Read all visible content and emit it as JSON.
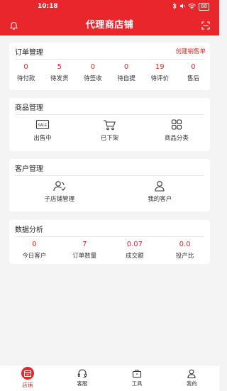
{
  "status_bar": {
    "time": "10:18",
    "battery": "88"
  },
  "header": {
    "title": "代理商店铺"
  },
  "orders": {
    "title": "订单管理",
    "link": "创建销售单",
    "stats": [
      {
        "value": "0",
        "label": "待付款"
      },
      {
        "value": "5",
        "label": "待发货"
      },
      {
        "value": "0",
        "label": "待签收"
      },
      {
        "value": "0",
        "label": "待自提"
      },
      {
        "value": "19",
        "label": "待评价"
      },
      {
        "value": "0",
        "label": "售后"
      }
    ]
  },
  "products": {
    "title": "商品管理",
    "items": [
      {
        "label": "出售中",
        "icon": "sale-tag-icon"
      },
      {
        "label": "已下架",
        "icon": "cart-icon"
      },
      {
        "label": "商品分类",
        "icon": "category-grid-icon"
      }
    ]
  },
  "customers": {
    "title": "客户管理",
    "items": [
      {
        "label": "子店铺管理",
        "icon": "sub-store-icon"
      },
      {
        "label": "我的客户",
        "icon": "user-icon"
      }
    ]
  },
  "analytics": {
    "title": "数据分析",
    "stats": [
      {
        "value": "0",
        "label": "今日客户"
      },
      {
        "value": "7",
        "label": "订单数量"
      },
      {
        "value": "0.07",
        "label": "成交额"
      },
      {
        "value": "0.0",
        "label": "投产比"
      }
    ]
  },
  "bottom_nav": [
    {
      "label": "店铺",
      "icon": "store-icon",
      "active": true
    },
    {
      "label": "客服",
      "icon": "headset-icon",
      "active": false
    },
    {
      "label": "工具",
      "icon": "toolbox-icon",
      "active": false
    },
    {
      "label": "我的",
      "icon": "profile-icon",
      "active": false
    }
  ],
  "colors": {
    "accent": "#e8262c",
    "background": "#f4f4f4"
  }
}
